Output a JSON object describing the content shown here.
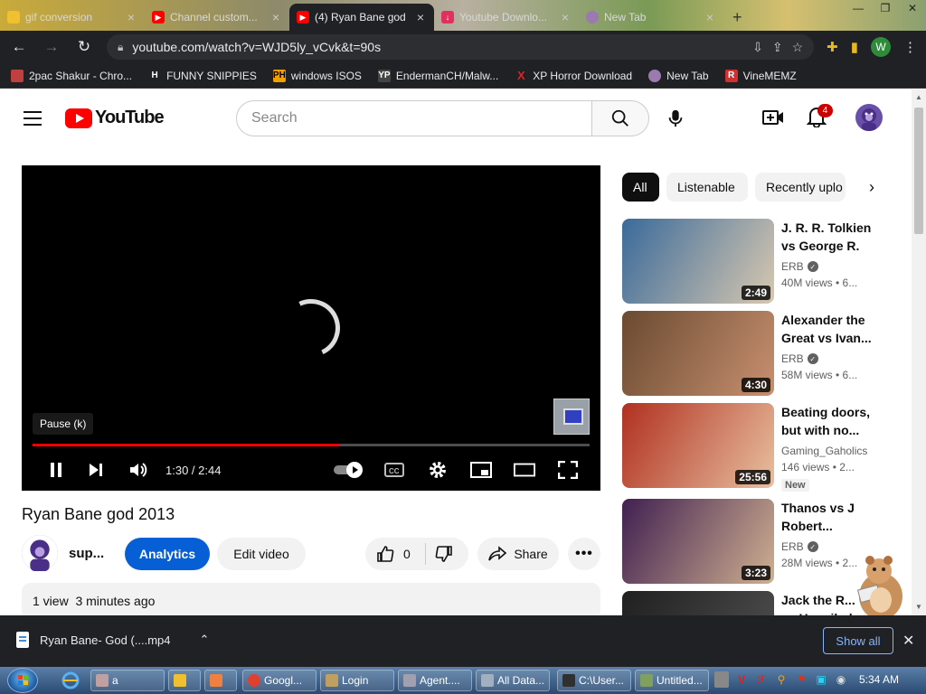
{
  "browser": {
    "tabs": [
      {
        "title": "gif conversion",
        "icon": "gif"
      },
      {
        "title": "Channel custom...",
        "icon": "youtube"
      },
      {
        "title": "(4) Ryan Bane god",
        "icon": "youtube",
        "active": true
      },
      {
        "title": "Youtube Downlo...",
        "icon": "download"
      },
      {
        "title": "New Tab",
        "icon": "globe"
      }
    ],
    "url": "youtube.com/watch?v=WJD5ly_vCvk&t=90s",
    "profile_initial": "W",
    "bookmarks": [
      {
        "label": "2pac Shakur - Chro...",
        "icon_text": "",
        "color": "#c04040"
      },
      {
        "label": "FUNNY SNIPPIES",
        "icon_text": "H",
        "color": "#ffffff"
      },
      {
        "label": "windows ISOS",
        "icon_text": "PH",
        "color": "#f0a000"
      },
      {
        "label": "EndermanCH/Malw...",
        "icon_text": "YP",
        "color": "#444444"
      },
      {
        "label": "XP Horror Download",
        "icon_text": "X",
        "color": "#e02020"
      },
      {
        "label": "New Tab",
        "icon_text": "",
        "color": "#9a7ab0"
      },
      {
        "label": "VineMEMZ",
        "icon_text": "R",
        "color": "#d03030"
      }
    ]
  },
  "youtube": {
    "logo_text": "YouTube",
    "search_placeholder": "Search",
    "notification_count": "4",
    "player": {
      "tooltip": "Pause (k)",
      "current_time": "1:30",
      "duration": "2:44",
      "time_display": "1:30 / 2:44",
      "progress_fraction": 0.55
    },
    "video_title": "Ryan Bane god 2013",
    "channel_name": "sup...",
    "buttons": {
      "analytics": "Analytics",
      "edit_video": "Edit video",
      "like_count": "0",
      "share": "Share"
    },
    "description_meta": "1 view  3 minutes ago",
    "chips": [
      "All",
      "Listenable",
      "Recently uplo"
    ],
    "recommendations": [
      {
        "title": "J. R. R. Tolkien vs George R. ...",
        "channel": "ERB",
        "verified": true,
        "meta": "40M views  • 6...",
        "duration": "2:49",
        "thumb_colors": [
          "#3a6a9a",
          "#d8c8b0"
        ]
      },
      {
        "title": "Alexander the Great vs Ivan...",
        "channel": "ERB",
        "verified": true,
        "meta": "58M views  • 6...",
        "duration": "4:30",
        "thumb_colors": [
          "#6a4a30",
          "#c89070"
        ]
      },
      {
        "title": "Beating doors, but with no...",
        "channel": "Gaming_Gaholics",
        "verified": false,
        "meta": "146 views  • 2...",
        "duration": "25:56",
        "new": "New",
        "thumb_colors": [
          "#b03020",
          "#e8c0a0"
        ]
      },
      {
        "title": "Thanos vs J Robert...",
        "channel": "ERB",
        "verified": true,
        "meta": "28M views  • 2...",
        "duration": "3:23",
        "thumb_colors": [
          "#402050",
          "#d0b090"
        ]
      },
      {
        "title": "Jack the R... vs Hannibal...",
        "channel": "",
        "verified": false,
        "meta": "",
        "duration": "",
        "thumb_colors": [
          "#202020",
          "#505050"
        ]
      }
    ]
  },
  "download_bar": {
    "file": "Ryan Bane- God (....mp4",
    "show_all": "Show all"
  },
  "taskbar": {
    "tasks": [
      {
        "label": "a",
        "color": "#c0a0a0"
      },
      {
        "label": "",
        "color": "#f0c030"
      },
      {
        "label": "",
        "color": "#f08040"
      },
      {
        "label": "Googl...",
        "color": "#e04030"
      },
      {
        "label": "Login",
        "color": "#c0a060"
      },
      {
        "label": "Agent....",
        "color": "#a0a0b0"
      },
      {
        "label": "All Data...",
        "color": "#a0b0c0"
      },
      {
        "label": "C:\\User...",
        "color": "#303030"
      },
      {
        "label": "Untitled...",
        "color": "#80a060"
      }
    ],
    "clock": "5:34 AM"
  }
}
